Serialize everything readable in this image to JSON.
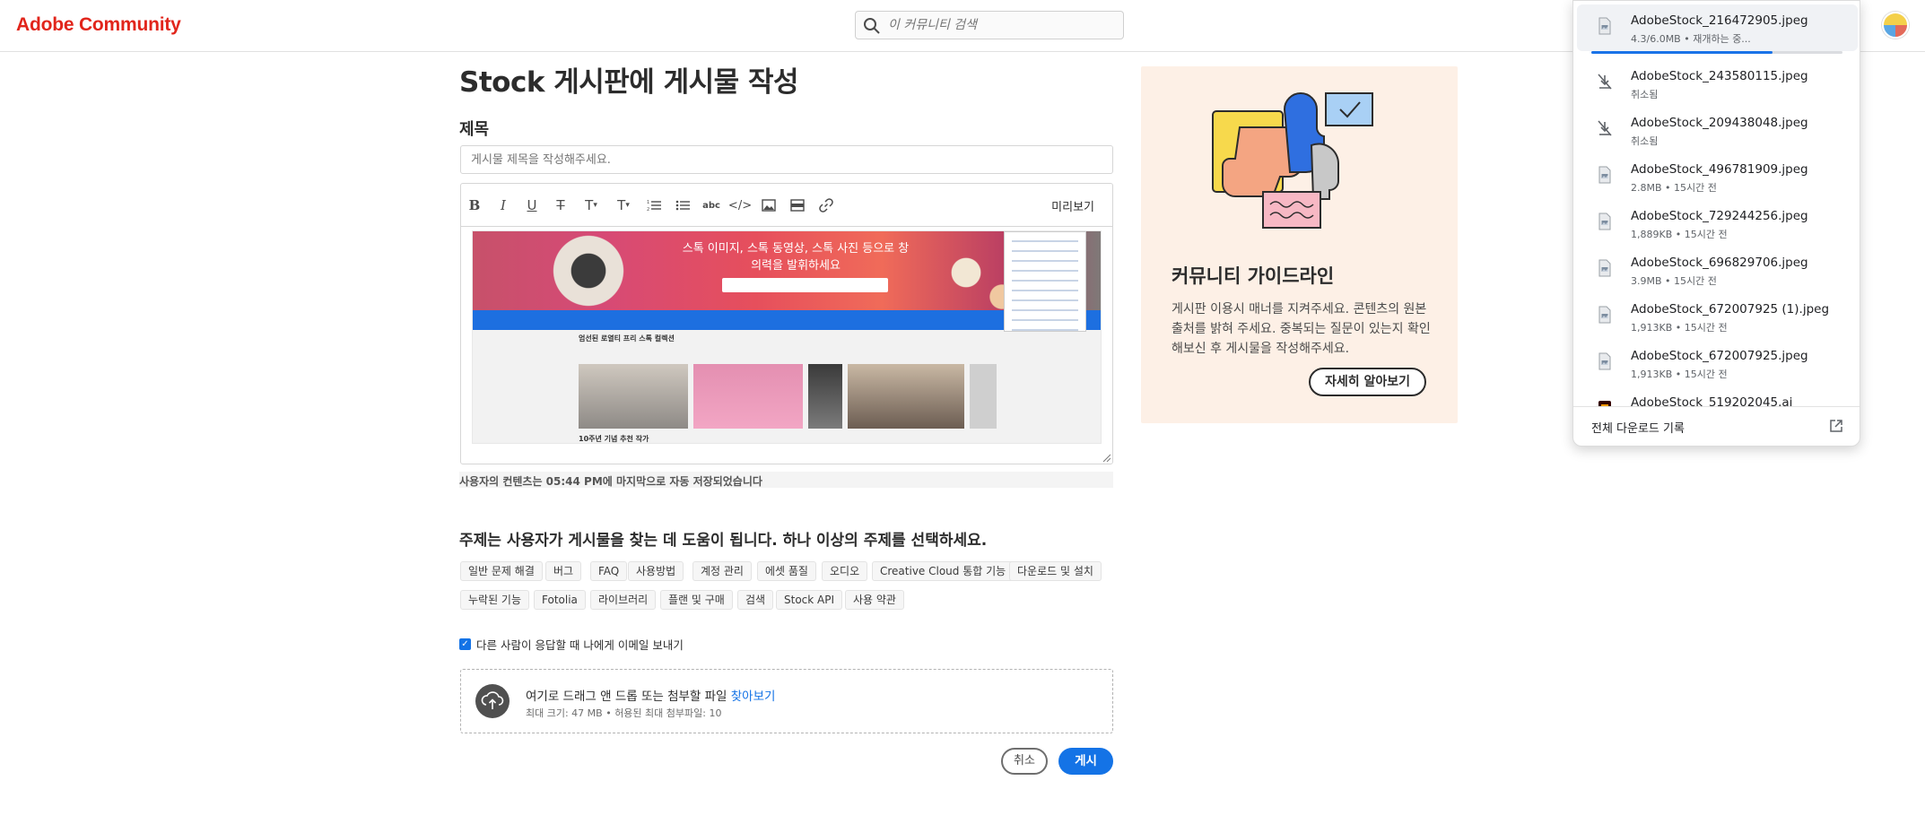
{
  "header": {
    "logo": "Adobe Community",
    "search_placeholder": "이 커뮤니티 검색"
  },
  "main": {
    "page_title": "Stock 게시판에 게시물 작성",
    "title_label": "제목",
    "title_placeholder": "게시물 제목을 작성해주세요.",
    "toolbar": {
      "icons": [
        "bold-icon",
        "italic-icon",
        "underline-icon",
        "strikethrough-icon",
        "text-size-icon",
        "text-style-icon",
        "numbered-list-icon",
        "bulleted-list-icon",
        "spellcheck-icon",
        "code-icon",
        "image-icon",
        "media-icon",
        "link-icon"
      ],
      "preview_label": "미리보기"
    },
    "embedded_image": {
      "hero_text": "스톡 이미지, 스톡 동영상, 스톡 사진 등으로 창의력을 발휘하세요",
      "sub_title": "엄선된 로열티 프리 스톡 컬렉션",
      "footer_text": "10주년 기념 추천 작가"
    },
    "autosave": "사용자의 컨텐츠는 05:44 PM에 마지막으로 자동 저장되었습니다",
    "topics_heading": "주제는 사용자가 게시물을 찾는 데 도움이 됩니다. 하나 이상의 주제를 선택하세요.",
    "topics_row1": [
      "일반 문제 해결",
      "버그",
      "FAQ",
      "사용방법",
      "계정 관리",
      "에셋 품질",
      "오디오",
      "Creative Cloud 통합 기능",
      "다운로드 및 설치"
    ],
    "topics_row2": [
      "누락된 기능",
      "Fotolia",
      "라이브러리",
      "플랜 및 구매",
      "검색",
      "Stock API",
      "사용 약관"
    ],
    "notify_label": "다른 사람이 응답할 때 나에게 이메일 보내기",
    "notify_checked": true,
    "attach": {
      "text": "여기로 드래그 앤 드롭 또는 첨부할 파일",
      "browse": "찾아보기",
      "limits": "최대 크기: 47 MB • 허용된 최대 첨부파일: 10"
    },
    "cancel_label": "취소",
    "post_label": "게시"
  },
  "guideline": {
    "title": "커뮤니티 가이드라인",
    "body": "게시판 이용시 매너를 지켜주세요. 콘텐츠의 원본 출처를 밝혀 주세요. 중복되는 질문이 있는지 확인해보신 후 게시물을 작성해주세요.",
    "button": "자세히 알아보기"
  },
  "downloads": {
    "items": [
      {
        "name": "AdobeStock_216472905.jpeg",
        "meta": "4.3/6.0MB • 재개하는 중...",
        "status": "resuming",
        "progress": 0.72
      },
      {
        "name": "AdobeStock_243580115.jpeg",
        "meta": "취소됨",
        "status": "cancelled"
      },
      {
        "name": "AdobeStock_209438048.jpeg",
        "meta": "취소됨",
        "status": "cancelled"
      },
      {
        "name": "AdobeStock_496781909.jpeg",
        "meta": "2.8MB • 15시간 전",
        "status": "done"
      },
      {
        "name": "AdobeStock_729244256.jpeg",
        "meta": "1,889KB • 15시간 전",
        "status": "done"
      },
      {
        "name": "AdobeStock_696829706.jpeg",
        "meta": "3.9MB • 15시간 전",
        "status": "done"
      },
      {
        "name": "AdobeStock_672007925 (1).jpeg",
        "meta": "1,913KB • 15시간 전",
        "status": "done"
      },
      {
        "name": "AdobeStock_672007925.jpeg",
        "meta": "1,913KB • 15시간 전",
        "status": "done"
      },
      {
        "name": "AdobeStock_519202045.ai",
        "meta": "",
        "status": "done-ai"
      }
    ],
    "footer_label": "전체 다운로드 기록"
  }
}
